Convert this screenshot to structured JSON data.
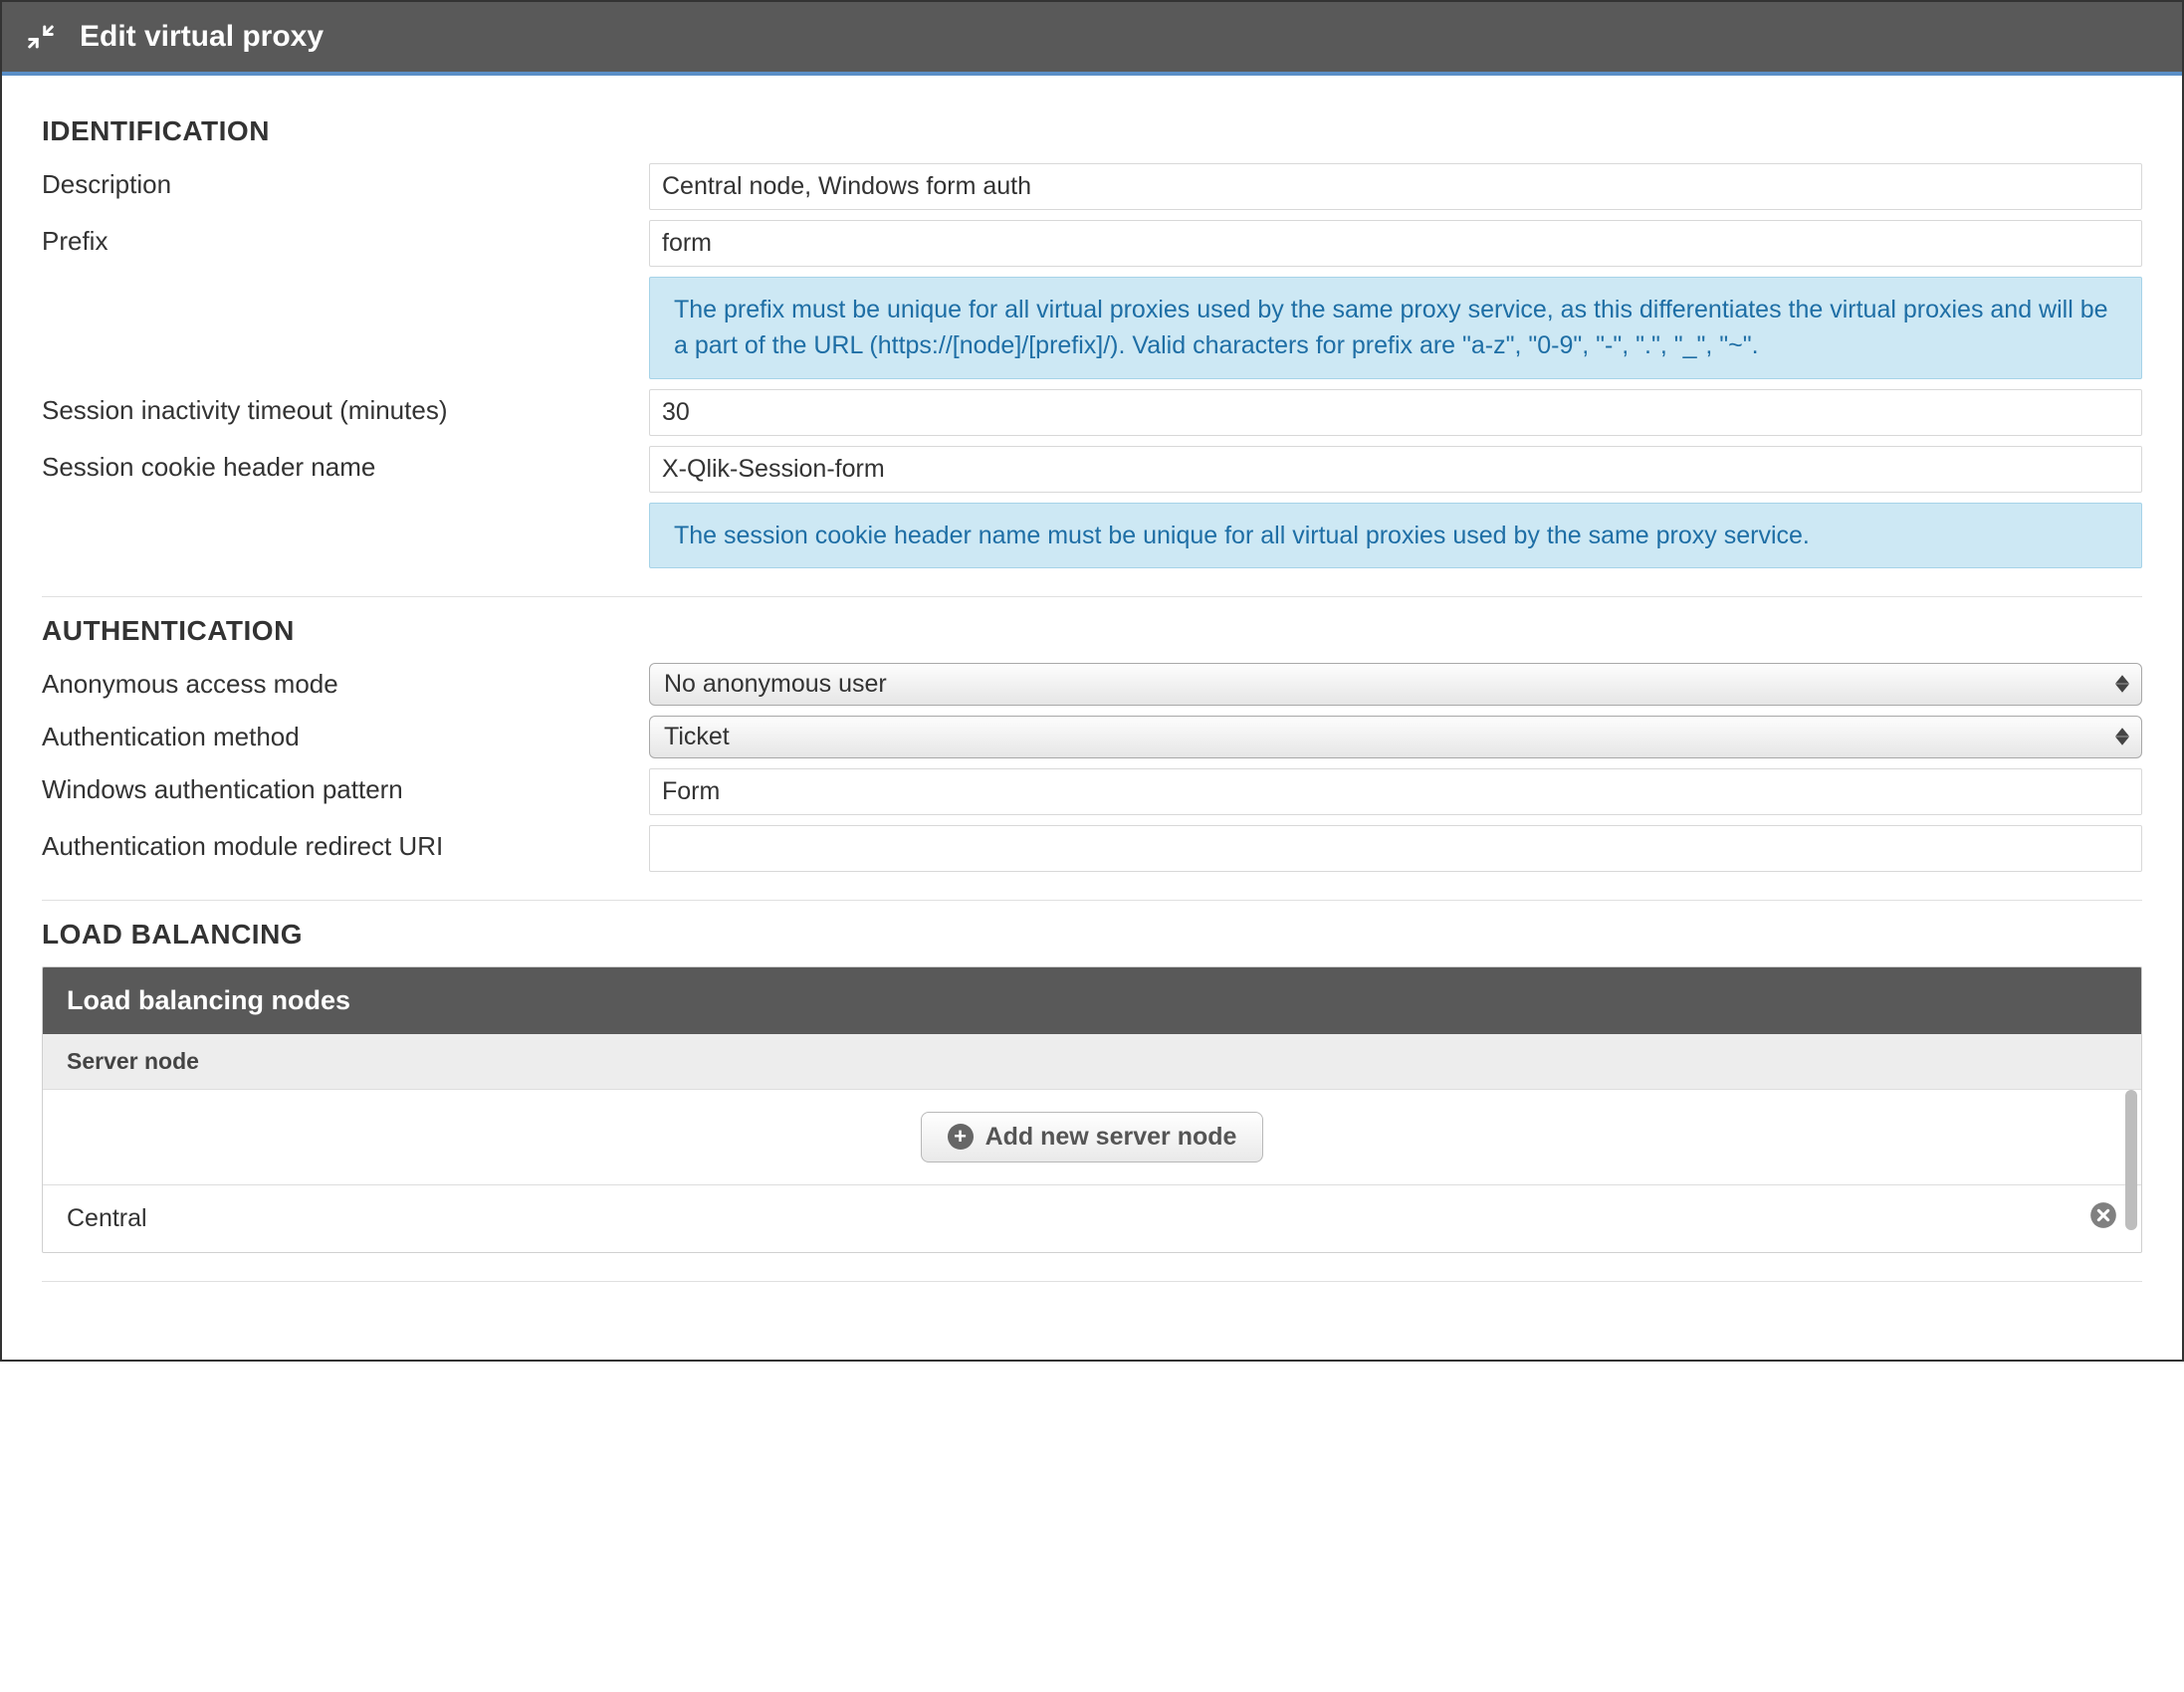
{
  "header": {
    "title": "Edit virtual proxy"
  },
  "sections": {
    "identification": {
      "heading": "IDENTIFICATION",
      "description_label": "Description",
      "description_value": "Central node, Windows form auth",
      "prefix_label": "Prefix",
      "prefix_value": "form",
      "prefix_info": "The prefix must be unique for all virtual proxies used by the same proxy service, as this differentiates the virtual proxies and will be a part of the URL (https://[node]/[prefix]/). Valid characters for prefix are \"a-z\", \"0-9\", \"-\", \".\", \"_\", \"~\".",
      "timeout_label": "Session inactivity timeout (minutes)",
      "timeout_value": "30",
      "cookie_label": "Session cookie header name",
      "cookie_value": "X-Qlik-Session-form",
      "cookie_info": "The session cookie header name must be unique for all virtual proxies used by the same proxy service."
    },
    "authentication": {
      "heading": "AUTHENTICATION",
      "anon_label": "Anonymous access mode",
      "anon_value": "No anonymous user",
      "method_label": "Authentication method",
      "method_value": "Ticket",
      "winpattern_label": "Windows authentication pattern",
      "winpattern_value": "Form",
      "redirect_label": "Authentication module redirect URI",
      "redirect_value": ""
    },
    "loadbalancing": {
      "heading": "LOAD BALANCING",
      "panel_title": "Load balancing nodes",
      "column_header": "Server node",
      "add_button": "Add new server node",
      "nodes": [
        {
          "name": "Central"
        }
      ]
    }
  }
}
